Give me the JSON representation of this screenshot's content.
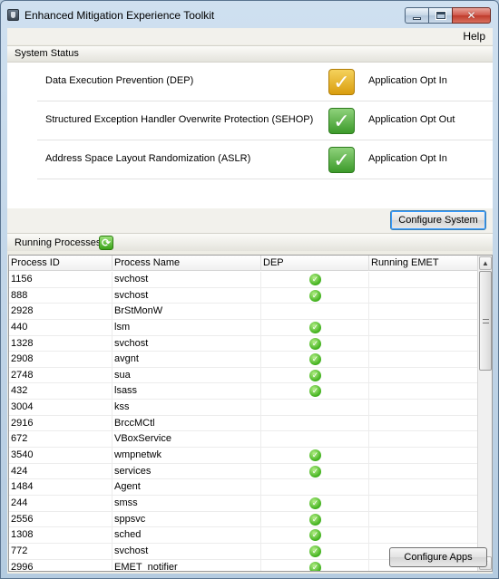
{
  "window": {
    "title": "Enhanced Mitigation Experience Toolkit"
  },
  "menu": {
    "help": "Help"
  },
  "system_status": {
    "header": "System Status",
    "items": [
      {
        "name": "Data Execution Prevention (DEP)",
        "value": "Application Opt In",
        "indicator": "warning-check",
        "color": "#e6b41c"
      },
      {
        "name": "Structured Exception Handler Overwrite Protection (SEHOP)",
        "value": "Application Opt Out",
        "indicator": "ok-check",
        "color": "#4aa83a"
      },
      {
        "name": "Address Space Layout Randomization (ASLR)",
        "value": "Application Opt In",
        "indicator": "ok-check",
        "color": "#4aa83a"
      }
    ],
    "configure_button": "Configure System"
  },
  "processes": {
    "header": "Running Processes",
    "columns": [
      "Process ID",
      "Process Name",
      "DEP",
      "Running EMET"
    ],
    "rows": [
      {
        "pid": "1156",
        "name": "svchost",
        "dep": true
      },
      {
        "pid": "888",
        "name": "svchost",
        "dep": true
      },
      {
        "pid": "2928",
        "name": "BrStMonW",
        "dep": false
      },
      {
        "pid": "440",
        "name": "lsm",
        "dep": true
      },
      {
        "pid": "1328",
        "name": "svchost",
        "dep": true
      },
      {
        "pid": "2908",
        "name": "avgnt",
        "dep": true
      },
      {
        "pid": "2748",
        "name": "sua",
        "dep": true
      },
      {
        "pid": "432",
        "name": "lsass",
        "dep": true
      },
      {
        "pid": "3004",
        "name": "kss",
        "dep": false
      },
      {
        "pid": "2916",
        "name": "BrccMCtl",
        "dep": false
      },
      {
        "pid": "672",
        "name": "VBoxService",
        "dep": false
      },
      {
        "pid": "3540",
        "name": "wmpnetwk",
        "dep": true
      },
      {
        "pid": "424",
        "name": "services",
        "dep": true
      },
      {
        "pid": "1484",
        "name": "Agent",
        "dep": false
      },
      {
        "pid": "244",
        "name": "smss",
        "dep": true
      },
      {
        "pid": "2556",
        "name": "sppsvc",
        "dep": true
      },
      {
        "pid": "1308",
        "name": "sched",
        "dep": true
      },
      {
        "pid": "772",
        "name": "svchost",
        "dep": true
      },
      {
        "pid": "2996",
        "name": "EMET_notifier",
        "dep": true
      }
    ],
    "configure_apps_button": "Configure Apps"
  }
}
